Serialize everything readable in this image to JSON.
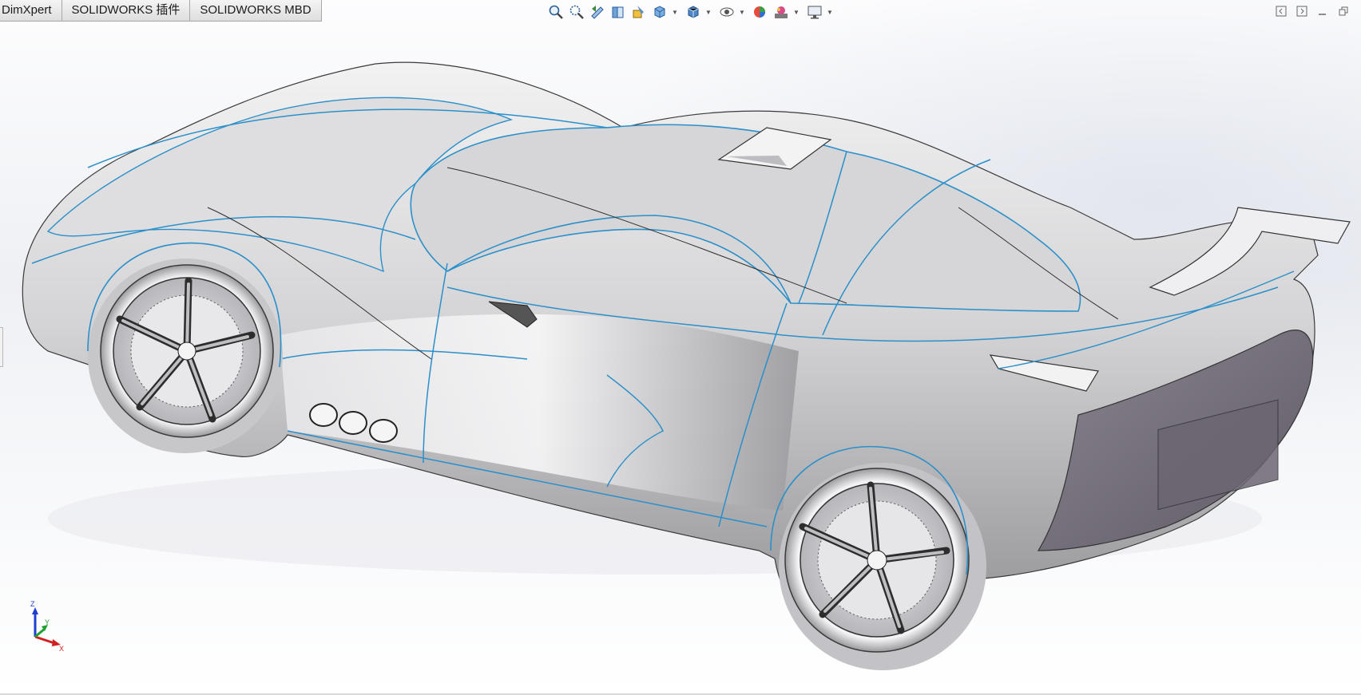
{
  "command_tabs": [
    {
      "label": "DimXpert"
    },
    {
      "label": "SOLIDWORKS 插件"
    },
    {
      "label": "SOLIDWORKS MBD"
    }
  ],
  "heads_up_toolbar": [
    {
      "icon": "zoom-to-fit-icon",
      "caret": false
    },
    {
      "icon": "zoom-to-area-icon",
      "caret": false
    },
    {
      "icon": "previous-view-icon",
      "caret": false
    },
    {
      "icon": "section-view-icon",
      "caret": false
    },
    {
      "icon": "dynamic-annotation-icon",
      "caret": false
    },
    {
      "icon": "view-orientation-icon",
      "caret": true
    },
    {
      "icon": "display-style-icon",
      "caret": true
    },
    {
      "icon": "hide-show-items-icon",
      "caret": true
    },
    {
      "icon": "edit-appearance-icon",
      "caret": false
    },
    {
      "icon": "apply-scene-icon",
      "caret": true
    },
    {
      "icon": "view-settings-icon",
      "caret": true
    }
  ],
  "window_controls": [
    "tile-left-icon",
    "tile-right-icon",
    "minimize-icon",
    "restore-icon"
  ],
  "model": {
    "name": "sports-car-3d-model"
  },
  "triad": {
    "z": "Z",
    "y": "Y",
    "x": "X"
  },
  "colors": {
    "edge": "#2b8fc9",
    "body": "#c9c9c9",
    "accent": "#1e6fd9"
  }
}
